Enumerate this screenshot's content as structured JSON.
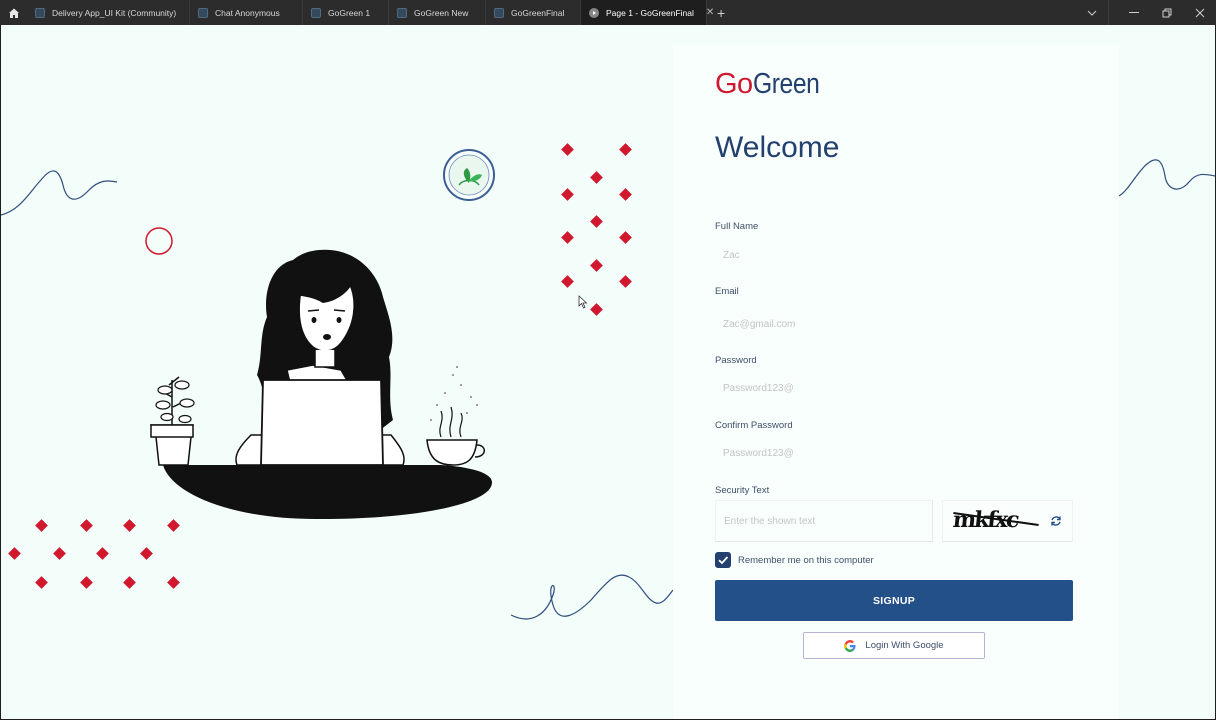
{
  "tabs": [
    {
      "label": "Delivery App_UI Kit (Community)",
      "active": false
    },
    {
      "label": "Chat Anonymous",
      "active": false
    },
    {
      "label": "GoGreen 1",
      "active": false
    },
    {
      "label": "GoGreen New",
      "active": false
    },
    {
      "label": "GoGreenFinal",
      "active": false
    },
    {
      "label": "Page 1 - GoGreenFinal",
      "active": true
    }
  ],
  "logo": {
    "go": "Go",
    "green": "Green"
  },
  "heading": "Welcome",
  "form": {
    "full_name": {
      "label": "Full Name",
      "placeholder": "Zac"
    },
    "email": {
      "label": "Email",
      "placeholder": "Zac@gmail.com"
    },
    "password": {
      "label": "Password",
      "placeholder": "Password123@"
    },
    "confirm_password": {
      "label": "Confirm Password",
      "placeholder": "Password123@"
    },
    "security": {
      "label": "Security Text",
      "placeholder": "Enter the shown text",
      "captcha": "mkfxc"
    },
    "remember": {
      "label": "Remember me on this computer",
      "checked": true
    },
    "signup_label": "SIGNUP",
    "google_label": "Login With Google"
  },
  "colors": {
    "accent": "#d0182e",
    "navy": "#23406e",
    "button": "#24508a",
    "background": "#f3fdf9"
  }
}
